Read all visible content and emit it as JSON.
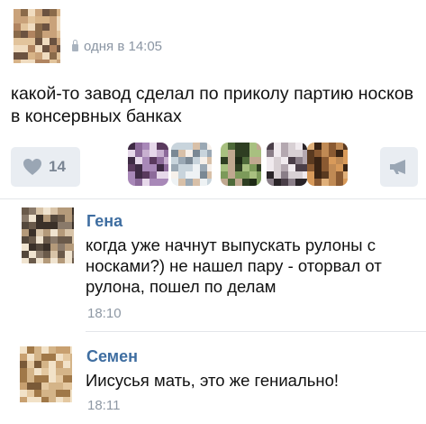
{
  "post": {
    "timestamp": "одня в 14:05",
    "text": "какой-то завод сделал по приколу партию носков в консервных банках",
    "likes": "14"
  },
  "icons": {
    "lock": "lock-icon",
    "like": "heart-icon",
    "share": "megaphone-icon"
  },
  "colors": {
    "accent_name": "#3f6ea1",
    "muted": "#8e98a4",
    "button_bg": "#e9edf2"
  },
  "comments": [
    {
      "author": "Гена",
      "text": "когда уже начнут выпускать рулоны с носками?) не нашел пару - оторвал от рулона, пошел по делам",
      "time": "18:10"
    },
    {
      "author": "Семен",
      "text": "Иисусья мать, это же гениально!",
      "time": "18:11"
    }
  ]
}
